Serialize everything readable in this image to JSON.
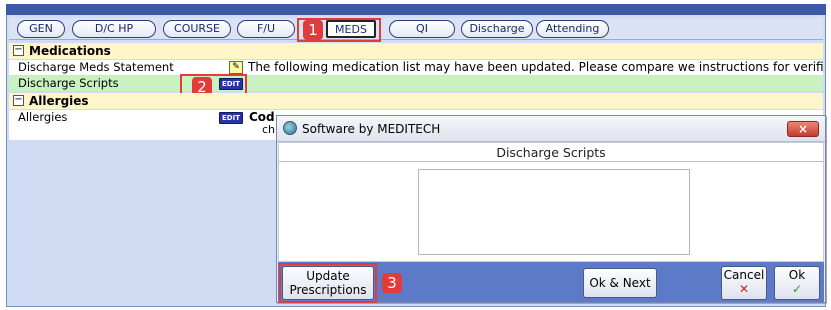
{
  "tabs": [
    {
      "label": "GEN"
    },
    {
      "label": "D/C HP"
    },
    {
      "label": "COURSE"
    },
    {
      "label": "F/U"
    },
    {
      "label": "MEDS"
    },
    {
      "label": "QI"
    },
    {
      "label": "Discharge"
    },
    {
      "label": "Attending"
    }
  ],
  "active_tab": "MEDS",
  "sections": {
    "medications": {
      "title": "Medications",
      "toggle": "−",
      "rows": [
        {
          "label": "Discharge Meds Statement",
          "text": "The following medication list may have been updated. Please compare we instructions for verifi"
        },
        {
          "label": "Discharge Scripts",
          "edit": "EDIT"
        }
      ]
    },
    "allergies": {
      "title": "Allergies",
      "toggle": "−",
      "rows": [
        {
          "label": "Allergies",
          "edit": "EDIT",
          "text_bold": "Cod",
          "text_small": "ch"
        }
      ]
    }
  },
  "callouts": [
    "1",
    "2",
    "3"
  ],
  "dialog": {
    "title": "Software by MEDITECH",
    "subtitle": "Discharge Scripts",
    "close_label": "×",
    "buttons": {
      "update_line1": "Update",
      "update_line2": "Prescriptions",
      "ok_next": "Ok & Next",
      "cancel": "Cancel",
      "cancel_icon": "✕",
      "ok": "Ok",
      "ok_icon": "✓"
    }
  },
  "colors": {
    "frame_bg": "#d0dcf4",
    "section_head": "#fef6c8",
    "green_row": "#c8f2c0",
    "edit_button": "#2834a6",
    "callout_red": "#e23b3b",
    "dialog_footer": "#5d7ac8"
  },
  "icons": [
    "note-edit-icon",
    "edit-icon",
    "meditech-logo-icon",
    "close-icon",
    "cancel-x-icon",
    "ok-check-icon"
  ]
}
